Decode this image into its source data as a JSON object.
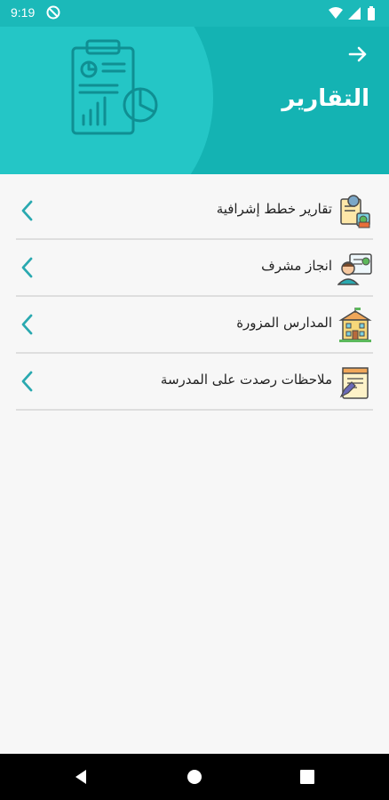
{
  "status_bar": {
    "time": "9:19",
    "icons": [
      "do-not-disturb-icon",
      "wifi-icon",
      "signal-icon",
      "battery-icon"
    ]
  },
  "header": {
    "title": "التقارير",
    "back_icon": "arrow-right-icon",
    "illustration": "report-chart-clipboard-icon"
  },
  "items": [
    {
      "label": "تقارير خطط إشرافية",
      "icon": "gear-document-icon"
    },
    {
      "label": "انجاز مشرف",
      "icon": "supervisor-icon"
    },
    {
      "label": "المدارس المزورة",
      "icon": "school-building-icon"
    },
    {
      "label": "ملاحظات رصدت على المدرسة",
      "icon": "notepad-pencil-icon"
    }
  ],
  "nav_bar": {
    "buttons": [
      "back-icon",
      "home-icon",
      "recents-icon"
    ]
  },
  "colors": {
    "header": "#14b3b3",
    "header_light": "#24c6c6",
    "chevron": "#2aa9b0",
    "text": "#222222"
  }
}
